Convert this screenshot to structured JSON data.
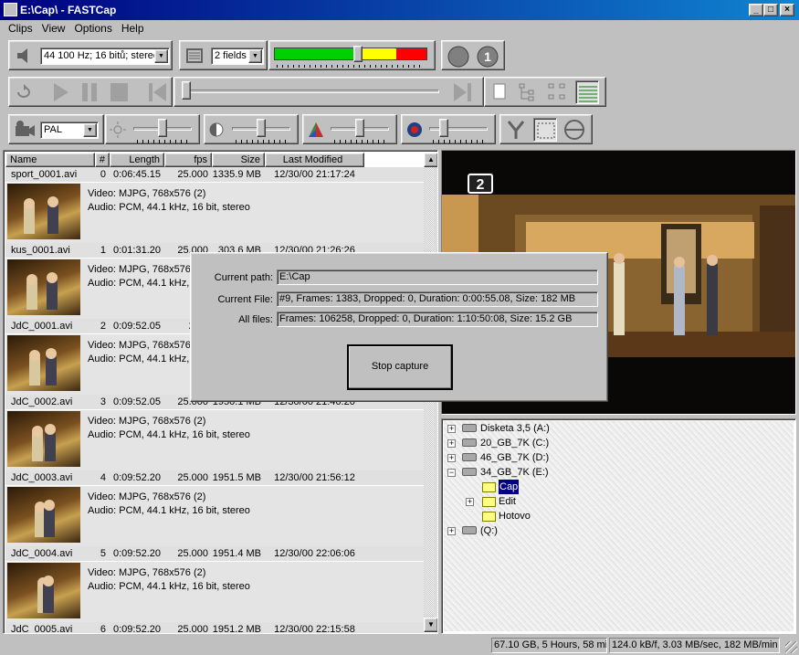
{
  "window": {
    "title": "E:\\Cap\\ - FASTCap",
    "minimize": "_",
    "maximize": "□",
    "close": "×"
  },
  "menu": [
    "Clips",
    "View",
    "Options",
    "Help"
  ],
  "audio": {
    "format": "44 100 Hz; 16 bitů; stereo",
    "icon": "speaker-icon"
  },
  "fields": {
    "value": "2 fields",
    "icon": "deinterlace-icon"
  },
  "level_meter": {
    "value": 0.55,
    "colors": [
      "#00d000",
      "#ffff00",
      "#ff0000"
    ]
  },
  "record_icons": [
    "record-icon",
    "info-icon"
  ],
  "transport": {
    "icons": [
      "loop-icon",
      "play-icon",
      "pause-icon",
      "stop-icon",
      "rewind-icon",
      "fast-forward-icon"
    ],
    "position": 0.0
  },
  "view_icons": [
    "single-page-icon",
    "tree-view-icon",
    "tree-view-alt-icon",
    "detail-list-icon"
  ],
  "video": {
    "standard": "PAL",
    "icon": "camera-icon",
    "brightness": 0.5,
    "contrast": 0.5,
    "color": 0.5,
    "hue": 0.2
  },
  "filter_icons": [
    "y-filter-icon",
    "crop-icon",
    "deinterlace-circle-icon"
  ],
  "list": {
    "columns": [
      "Name",
      "#",
      "Length",
      "fps",
      "Size",
      "Last Modified"
    ],
    "rows": [
      {
        "name": "sport_0001.avi",
        "num": "0",
        "length": "0:06:45.15",
        "fps": "25.000",
        "size": "1335.9 MB",
        "modified": "12/30/00 21:17:24",
        "video": "Video: MJPG, 768x576 (2)",
        "audio": "Audio: PCM, 44.1 kHz, 16 bit, stereo"
      },
      {
        "name": "kus_0001.avi",
        "num": "1",
        "length": "0:01:31.20",
        "fps": "25.000",
        "size": "303.6 MB",
        "modified": "12/30/00 21:26:26",
        "video": "Video: MJPG, 768x576",
        "audio": "Audio: PCM, 44.1 kHz,"
      },
      {
        "name": "JdC_0001.avi",
        "num": "2",
        "length": "0:09:52.05",
        "fps": "25.0",
        "size": "",
        "modified": "",
        "video": "Video: MJPG, 768x576",
        "audio": "Audio: PCM, 44.1 kHz,"
      },
      {
        "name": "JdC_0002.avi",
        "num": "3",
        "length": "0:09:52.05",
        "fps": "25.000",
        "size": "1950.1 MB",
        "modified": "12/30/00 21:46:20",
        "video": "Video: MJPG, 768x576 (2)",
        "audio": "Audio: PCM, 44.1 kHz, 16 bit, stereo"
      },
      {
        "name": "JdC_0003.avi",
        "num": "4",
        "length": "0:09:52.20",
        "fps": "25.000",
        "size": "1951.5 MB",
        "modified": "12/30/00 21:56:12",
        "video": "Video: MJPG, 768x576 (2)",
        "audio": "Audio: PCM, 44.1 kHz, 16 bit, stereo"
      },
      {
        "name": "JdC_0004.avi",
        "num": "5",
        "length": "0:09:52.20",
        "fps": "25.000",
        "size": "1951.4 MB",
        "modified": "12/30/00 22:06:06",
        "video": "Video: MJPG, 768x576 (2)",
        "audio": "Audio: PCM, 44.1 kHz, 16 bit, stereo"
      },
      {
        "name": "JdC_0005.avi",
        "num": "6",
        "length": "0:09:52.20",
        "fps": "25.000",
        "size": "1951.2 MB",
        "modified": "12/30/00 22:15:58",
        "video": "",
        "audio": ""
      }
    ]
  },
  "dialog": {
    "labels": {
      "path": "Current path:",
      "file": "Current File:",
      "all": "All files:"
    },
    "path": "E:\\Cap",
    "current_file": "#9, Frames: 1383, Dropped: 0, Duration: 0:00:55.08, Size: 182 MB",
    "all_files": "Frames: 106258, Dropped: 0, Duration: 1:10:50:08, Size: 15.2 GB",
    "stop_button": "Stop capture"
  },
  "channel_logo": "2",
  "tree": [
    {
      "label": "Disketa 3,5 (A:)",
      "expander": "+",
      "type": "drive"
    },
    {
      "label": "20_GB_7K (C:)",
      "expander": "+",
      "type": "drive"
    },
    {
      "label": "46_GB_7K (D:)",
      "expander": "+",
      "type": "drive"
    },
    {
      "label": "34_GB_7K (E:)",
      "expander": "−",
      "type": "drive"
    },
    {
      "label": "Cap",
      "expander": "",
      "type": "folder",
      "selected": true
    },
    {
      "label": "Edit",
      "expander": "+",
      "type": "folder"
    },
    {
      "label": "Hotovo",
      "expander": "",
      "type": "folder"
    },
    {
      "label": "(Q:)",
      "expander": "+",
      "type": "drive"
    }
  ],
  "status": {
    "free": "67.10 GB, 5 Hours, 58 min",
    "rate": "124.0 kB/f, 3.03 MB/sec, 182 MB/min"
  }
}
